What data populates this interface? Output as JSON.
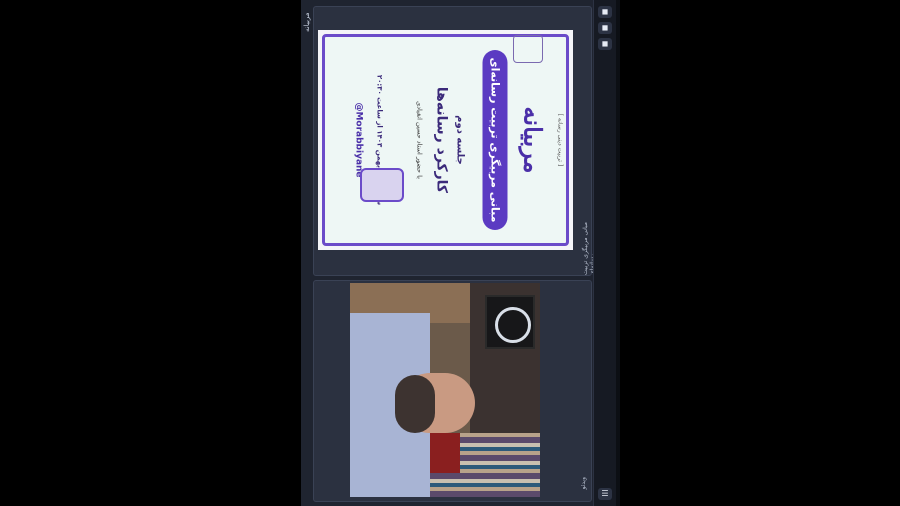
{
  "app": {
    "title": "مربیانه"
  },
  "panels": {
    "top_label": "مبانی مربیگری تربیت رسانه‌ای",
    "bottom_label": "ویدئو"
  },
  "sidebar": {
    "buttons": [
      "◼",
      "◼",
      "◼",
      "☰"
    ]
  },
  "slide": {
    "header": "[ تربیت دینی رسانه ]",
    "title": "مربیانه",
    "course": "مبانی مربیگری تربیت رسانه‌ای",
    "session": "جلسه دوم",
    "topic": "کارکرد رسانه‌ها",
    "presenter": "با حضور استاد حسین انقیادی",
    "date": "سه‌شنبه ۹ بهمن ۱۴۰۳ از ساعت ۲۰:۳۰",
    "handle": "@Morabbiyane"
  },
  "colors": {
    "accent": "#5b3bc2",
    "app_bg": "#1f2430"
  }
}
